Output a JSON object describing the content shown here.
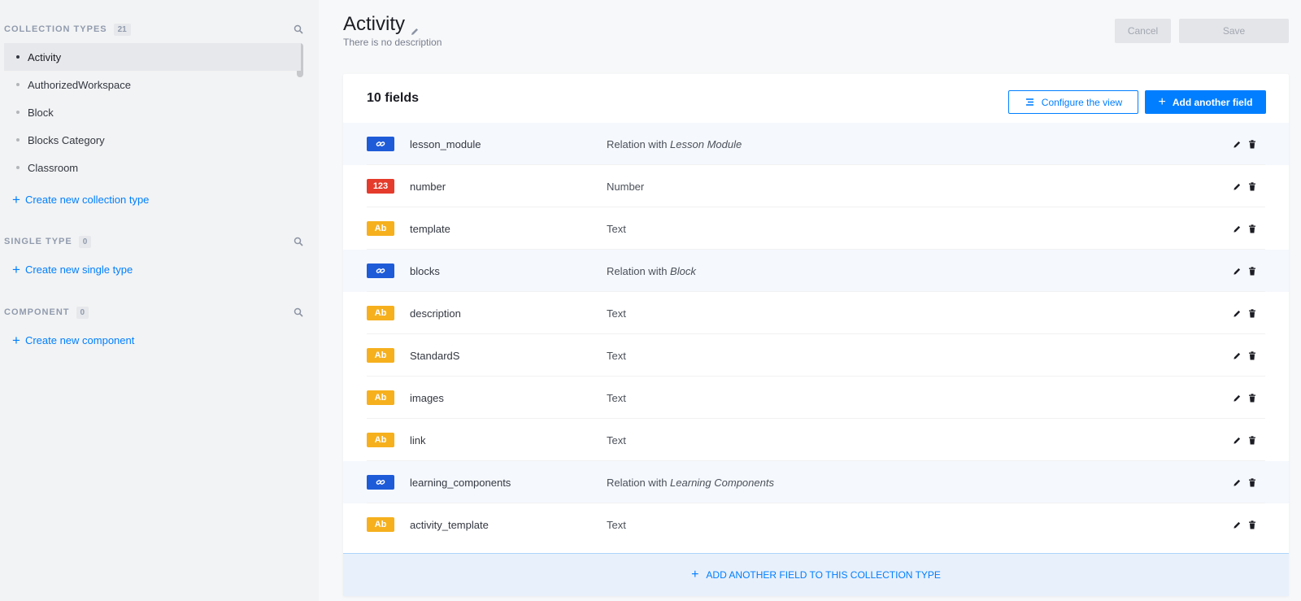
{
  "sidebar": {
    "collection_types": {
      "title": "COLLECTION TYPES",
      "count": "21",
      "items": [
        {
          "label": "Activity"
        },
        {
          "label": "AuthorizedWorkspace"
        },
        {
          "label": "Block"
        },
        {
          "label": "Blocks Category"
        },
        {
          "label": "Classroom"
        }
      ],
      "create_label": "Create new collection type"
    },
    "single_type": {
      "title": "SINGLE TYPE",
      "count": "0",
      "create_label": "Create new single type"
    },
    "component": {
      "title": "COMPONENT",
      "count": "0",
      "create_label": "Create new component"
    }
  },
  "header": {
    "title": "Activity",
    "description": "There is no description",
    "cancel_label": "Cancel",
    "save_label": "Save"
  },
  "card": {
    "fields_count": "10 fields",
    "configure_label": "Configure the view",
    "add_label": "Add another field",
    "add_bottom_label": "ADD ANOTHER FIELD TO THIS COLLECTION TYPE"
  },
  "fields": [
    {
      "name": "lesson_module",
      "type": "Relation with ",
      "target": "Lesson Module",
      "badge": "rel"
    },
    {
      "name": "number",
      "type": "Number",
      "target": "",
      "badge": "num",
      "badge_text": "123"
    },
    {
      "name": "template",
      "type": "Text",
      "target": "",
      "badge": "txt",
      "badge_text": "Ab"
    },
    {
      "name": "blocks",
      "type": "Relation with ",
      "target": "Block",
      "badge": "rel"
    },
    {
      "name": "description",
      "type": "Text",
      "target": "",
      "badge": "txt",
      "badge_text": "Ab"
    },
    {
      "name": "StandardS",
      "type": "Text",
      "target": "",
      "badge": "txt",
      "badge_text": "Ab"
    },
    {
      "name": "images",
      "type": "Text",
      "target": "",
      "badge": "txt",
      "badge_text": "Ab"
    },
    {
      "name": "link",
      "type": "Text",
      "target": "",
      "badge": "txt",
      "badge_text": "Ab"
    },
    {
      "name": "learning_components",
      "type": "Relation with ",
      "target": "Learning Components",
      "badge": "rel"
    },
    {
      "name": "activity_template",
      "type": "Text",
      "target": "",
      "badge": "txt",
      "badge_text": "Ab"
    }
  ],
  "colors": {
    "accent": "#007eff",
    "relation_badge": "#1e5bd8",
    "number_badge": "#e53b2c",
    "text_badge": "#f6b01e"
  }
}
